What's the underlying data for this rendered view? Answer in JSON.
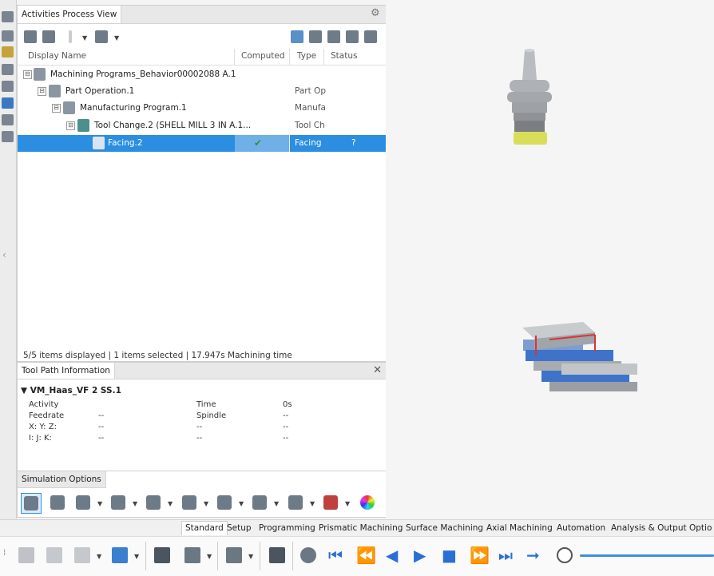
{
  "panel": {
    "tab_label": "Activities Process View",
    "columns": [
      "Display Name",
      "Computed",
      "Type",
      "Status"
    ],
    "rows": [
      {
        "label": "Machining Programs_Behavior00002088 A.1",
        "type": "",
        "status": "",
        "expander": "⊟",
        "selected": false
      },
      {
        "label": "Part Operation.1",
        "type": "Part Op",
        "status": "",
        "expander": "⊟",
        "selected": false
      },
      {
        "label": "Manufacturing Program.1",
        "type": "Manufa",
        "status": "",
        "expander": "⊟",
        "selected": false
      },
      {
        "label": "Tool Change.2 (SHELL MILL 3 IN A.1...",
        "type": "Tool Ch",
        "status": "",
        "expander": "⊟",
        "selected": false
      },
      {
        "label": "Facing.2",
        "type": "Facing",
        "status": "?",
        "expander": "",
        "selected": true
      }
    ],
    "status_line": "5/5 items displayed | 1 items selected | 17.947s Machining time"
  },
  "toolpath": {
    "tab_label": "Tool Path Information",
    "machine": "▼ VM_Haas_VF 2 SS.1",
    "rows": [
      {
        "k1": "Activity",
        "v1": "",
        "k2": "Time",
        "v2": "0s"
      },
      {
        "k1": "Feedrate",
        "v1": "--",
        "k2": "Spindle",
        "v2": "--"
      },
      {
        "k1": "X: Y: Z:",
        "v1": "--",
        "k2": "--",
        "v2": "--"
      },
      {
        "k1": "I: J: K:",
        "v1": "--",
        "k2": "--",
        "v2": "--"
      }
    ]
  },
  "simulation": {
    "tab_label": "Simulation Options"
  },
  "ribbon": {
    "tabs": [
      "Standard",
      "Setup",
      "Programming",
      "Prismatic Machining",
      "Surface Machining",
      "Axial Machining",
      "Automation",
      "Analysis & Output",
      "Optio"
    ],
    "active_tab": "Standard"
  },
  "colors": {
    "selection": "#2b8ee0",
    "play_controls": "#2b6fd6",
    "tool_body": "#b8bcc0",
    "tool_tip": "#d8de5a",
    "vise_blue": "#3f73c9",
    "vise_red": "#d33"
  }
}
